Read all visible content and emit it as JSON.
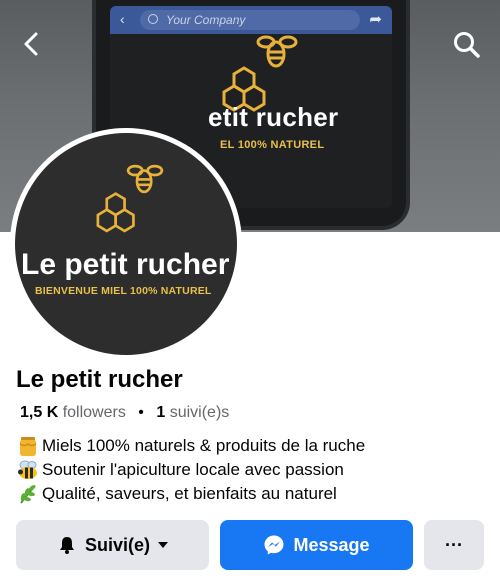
{
  "cover": {
    "phone_search_placeholder": "Your Company",
    "title": "etit rucher",
    "subtitle": "EL 100% NATUREL"
  },
  "avatar": {
    "title": "Le petit rucher",
    "subtitle": "BIENVENUE MIEL 100% NATUREL"
  },
  "profile": {
    "name": "Le petit rucher",
    "followers_count": "1,5 K",
    "followers_label": "followers",
    "separator": "•",
    "following_count": "1",
    "following_label": "suivi(e)s"
  },
  "bio": [
    {
      "icon": "honey-pot-icon",
      "text": "Miels 100% naturels & produits de la ruche"
    },
    {
      "icon": "bee-icon",
      "text": "Soutenir l'apiculture locale avec passion"
    },
    {
      "icon": "herb-icon",
      "text": "Qualité, saveurs, et bienfaits au naturel"
    }
  ],
  "actions": {
    "follow_label": "Suivi(e)",
    "message_label": "Message",
    "more_label": "···"
  },
  "colors": {
    "primary": "#1877f2",
    "secondary_button": "#e4e6eb",
    "logo_gold": "#e8b23a"
  }
}
